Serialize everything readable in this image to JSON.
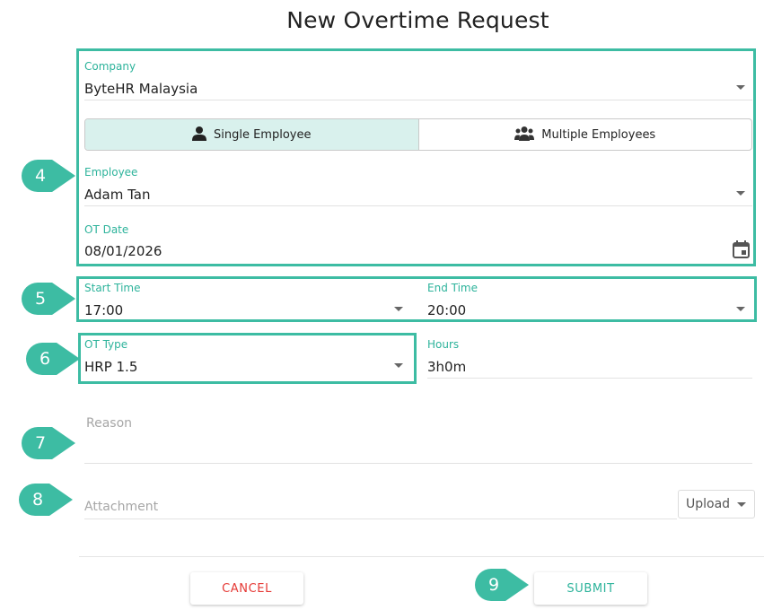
{
  "title": "New Overtime Request",
  "company": {
    "label": "Company",
    "value": "ByteHR Malaysia"
  },
  "mode_toggle": {
    "single_label": "Single Employee",
    "multiple_label": "Multiple Employees",
    "selected": "single"
  },
  "employee": {
    "label": "Employee",
    "value": "Adam Tan"
  },
  "ot_date": {
    "label": "OT Date",
    "value": "08/01/2026"
  },
  "start_time": {
    "label": "Start Time",
    "value": "17:00"
  },
  "end_time": {
    "label": "End Time",
    "value": "20:00"
  },
  "ot_type": {
    "label": "OT Type",
    "value": "HRP 1.5"
  },
  "hours": {
    "label": "Hours",
    "value": "3h0m"
  },
  "reason": {
    "placeholder": "Reason"
  },
  "attachment": {
    "placeholder": "Attachment",
    "upload_label": "Upload"
  },
  "buttons": {
    "cancel": "CANCEL",
    "submit": "SUBMIT"
  },
  "annotations": [
    "4",
    "5",
    "6",
    "7",
    "8",
    "9"
  ],
  "colors": {
    "accent": "#2db39b",
    "highlight": "#3dbca3",
    "cancel": "#e53935",
    "toggle_active": "#d9f1ed"
  }
}
